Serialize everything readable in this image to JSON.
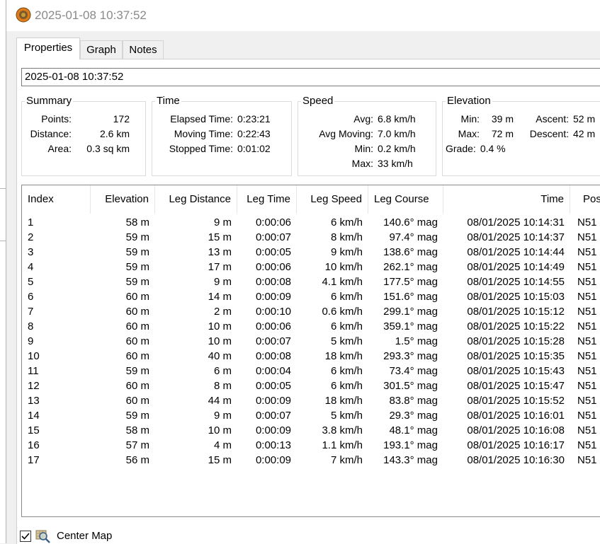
{
  "window": {
    "title": "2025-01-08 10:37:52"
  },
  "tabs": [
    {
      "label": "Properties",
      "active": true
    },
    {
      "label": "Graph",
      "active": false
    },
    {
      "label": "Notes",
      "active": false
    }
  ],
  "name_field": {
    "value": "2025-01-08 10:37:52"
  },
  "summary": {
    "label": "Summary",
    "points_label": "Points:",
    "points_value": "172",
    "distance_label": "Distance:",
    "distance_value": "2.6 km",
    "area_label": "Area:",
    "area_value": "0.3 sq km"
  },
  "time": {
    "label": "Time",
    "elapsed_label": "Elapsed Time:",
    "elapsed_value": "0:23:21",
    "moving_label": "Moving Time:",
    "moving_value": "0:22:43",
    "stopped_label": "Stopped Time:",
    "stopped_value": "0:01:02"
  },
  "speed": {
    "label": "Speed",
    "avg_label": "Avg:",
    "avg_value": "6.8 km/h",
    "avg_moving_label": "Avg Moving:",
    "avg_moving_value": "7.0 km/h",
    "min_label": "Min:",
    "min_value": "0.2 km/h",
    "max_label": "Max:",
    "max_value": "33 km/h"
  },
  "elevation": {
    "label": "Elevation",
    "min_label": "Min:",
    "min_value": "39 m",
    "max_label": "Max:",
    "max_value": "72 m",
    "grade_label": "Grade:",
    "grade_value": "0.4 %",
    "ascent_label": "Ascent:",
    "ascent_value": "52 m",
    "descent_label": "Descent:",
    "descent_value": "42 m"
  },
  "table": {
    "columns": [
      "Index",
      "Elevation",
      "Leg Distance",
      "Leg Time",
      "Leg Speed",
      "Leg Course",
      "Time",
      "Position"
    ],
    "rows": [
      [
        "1",
        "58 m",
        "9 m",
        "0:00:06",
        "6 km/h",
        "140.6° mag",
        "08/01/2025 10:14:31",
        "N51"
      ],
      [
        "2",
        "59 m",
        "15 m",
        "0:00:07",
        "8 km/h",
        "97.4° mag",
        "08/01/2025 10:14:37",
        "N51"
      ],
      [
        "3",
        "59 m",
        "13 m",
        "0:00:05",
        "9 km/h",
        "138.6° mag",
        "08/01/2025 10:14:44",
        "N51"
      ],
      [
        "4",
        "59 m",
        "17 m",
        "0:00:06",
        "10 km/h",
        "262.1° mag",
        "08/01/2025 10:14:49",
        "N51"
      ],
      [
        "5",
        "59 m",
        "9 m",
        "0:00:08",
        "4.1 km/h",
        "177.5° mag",
        "08/01/2025 10:14:55",
        "N51"
      ],
      [
        "6",
        "60 m",
        "14 m",
        "0:00:09",
        "6 km/h",
        "151.6° mag",
        "08/01/2025 10:15:03",
        "N51"
      ],
      [
        "7",
        "60 m",
        "2 m",
        "0:00:10",
        "0.6 km/h",
        "299.1° mag",
        "08/01/2025 10:15:12",
        "N51"
      ],
      [
        "8",
        "60 m",
        "10 m",
        "0:00:06",
        "6 km/h",
        "359.1° mag",
        "08/01/2025 10:15:22",
        "N51"
      ],
      [
        "9",
        "60 m",
        "10 m",
        "0:00:07",
        "5 km/h",
        "1.5° mag",
        "08/01/2025 10:15:28",
        "N51"
      ],
      [
        "10",
        "60 m",
        "40 m",
        "0:00:08",
        "18 km/h",
        "293.3° mag",
        "08/01/2025 10:15:35",
        "N51"
      ],
      [
        "11",
        "59 m",
        "6 m",
        "0:00:04",
        "6 km/h",
        "73.4° mag",
        "08/01/2025 10:15:43",
        "N51"
      ],
      [
        "12",
        "60 m",
        "8 m",
        "0:00:05",
        "6 km/h",
        "301.5° mag",
        "08/01/2025 10:15:47",
        "N51"
      ],
      [
        "13",
        "60 m",
        "44 m",
        "0:00:09",
        "18 km/h",
        "83.8° mag",
        "08/01/2025 10:15:52",
        "N51"
      ],
      [
        "14",
        "59 m",
        "9 m",
        "0:00:07",
        "5 km/h",
        "29.3° mag",
        "08/01/2025 10:16:01",
        "N51"
      ],
      [
        "15",
        "58 m",
        "10 m",
        "0:00:09",
        "3.8 km/h",
        "48.1° mag",
        "08/01/2025 10:16:08",
        "N51"
      ],
      [
        "16",
        "57 m",
        "4 m",
        "0:00:13",
        "1.1 km/h",
        "193.1° mag",
        "08/01/2025 10:16:17",
        "N51"
      ],
      [
        "17",
        "56 m",
        "15 m",
        "0:00:09",
        "7 km/h",
        "143.3° mag",
        "08/01/2025 10:16:30",
        "N51"
      ]
    ]
  },
  "center_map": {
    "label": "Center Map",
    "checked": true
  },
  "icons": {
    "app": "gps-track-icon",
    "center_map": "magnifier-map-icon"
  },
  "colors": {
    "title_text": "#8a8a8a",
    "app_icon_ring": "#e07b1a",
    "app_icon_core": "#7a5a2a"
  }
}
